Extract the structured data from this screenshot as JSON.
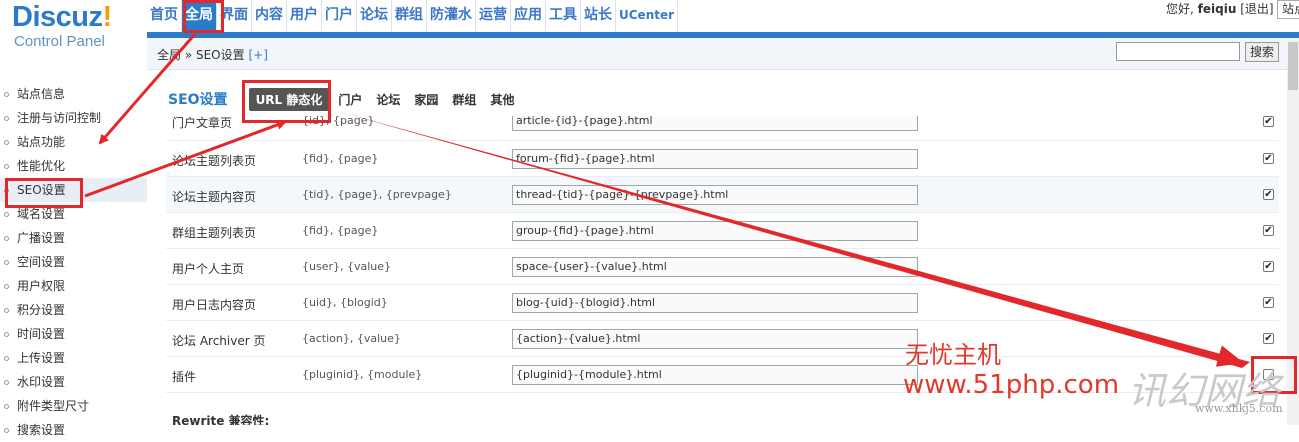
{
  "header": {
    "logo_main": "Discuz",
    "logo_bang": "!",
    "logo_sub": "Control Panel",
    "nav": [
      {
        "label": "首页",
        "active": false
      },
      {
        "label": "全局",
        "active": true
      },
      {
        "label": "界面",
        "active": false
      },
      {
        "label": "内容",
        "active": false
      },
      {
        "label": "用户",
        "active": false
      },
      {
        "label": "门户",
        "active": false
      },
      {
        "label": "论坛",
        "active": false
      },
      {
        "label": "群组",
        "active": false
      },
      {
        "label": "防灌水",
        "active": false
      },
      {
        "label": "运营",
        "active": false
      },
      {
        "label": "应用",
        "active": false
      },
      {
        "label": "工具",
        "active": false
      },
      {
        "label": "站长",
        "active": false
      },
      {
        "label": "UCenter",
        "active": false
      }
    ],
    "user_greeting": "您好, ",
    "username": "feiqiu",
    "logout": "[退出]",
    "site_box": "站点"
  },
  "crumb": {
    "path": "全局 » SEO设置",
    "plus": "[+]",
    "search_button": "搜索"
  },
  "sidebar": {
    "items": [
      "站点信息",
      "注册与访问控制",
      "站点功能",
      "性能优化",
      "SEO设置",
      "域名设置",
      "广播设置",
      "空间设置",
      "用户权限",
      "积分设置",
      "时间设置",
      "上传设置",
      "水印设置",
      "附件类型尺寸",
      "搜索设置"
    ],
    "active_index": 4
  },
  "tabs": {
    "title": "SEO设置",
    "items": [
      "URL 静态化",
      "门户",
      "论坛",
      "家园",
      "群组",
      "其他"
    ],
    "active_index": 0
  },
  "rows": [
    {
      "name": "门户文章页",
      "vars": "{id}, {page}",
      "value": "article-{id}-{page}.html",
      "checked": true
    },
    {
      "name": "论坛主题列表页",
      "vars": "{fid}, {page}",
      "value": "forum-{fid}-{page}.html",
      "checked": true
    },
    {
      "name": "论坛主题内容页",
      "vars": "{tid}, {page}, {prevpage}",
      "value": "thread-{tid}-{page}-{prevpage}.html",
      "checked": true
    },
    {
      "name": "群组主题列表页",
      "vars": "{fid}, {page}",
      "value": "group-{fid}-{page}.html",
      "checked": true
    },
    {
      "name": "用户个人主页",
      "vars": "{user}, {value}",
      "value": "space-{user}-{value}.html",
      "checked": true
    },
    {
      "name": "用户日志内容页",
      "vars": "{uid}, {blogid}",
      "value": "blog-{uid}-{blogid}.html",
      "checked": true
    },
    {
      "name": "论坛 Archiver 页",
      "vars": "{action}, {value}",
      "value": "{action}-{value}.html",
      "checked": true
    },
    {
      "name": "插件",
      "vars": "{pluginid}, {module}",
      "value": "{pluginid}-{module}.html",
      "checked": false
    }
  ],
  "section_label": "Rewrite 兼容性:",
  "watermark": {
    "line1": "无忧主机",
    "line2": "www.51php.com",
    "gray_big": "讯幻网络",
    "gray_small": "www.xhkj5.com"
  },
  "colors": {
    "accent": "#2a7cc8",
    "annotation": "#e2282a"
  }
}
